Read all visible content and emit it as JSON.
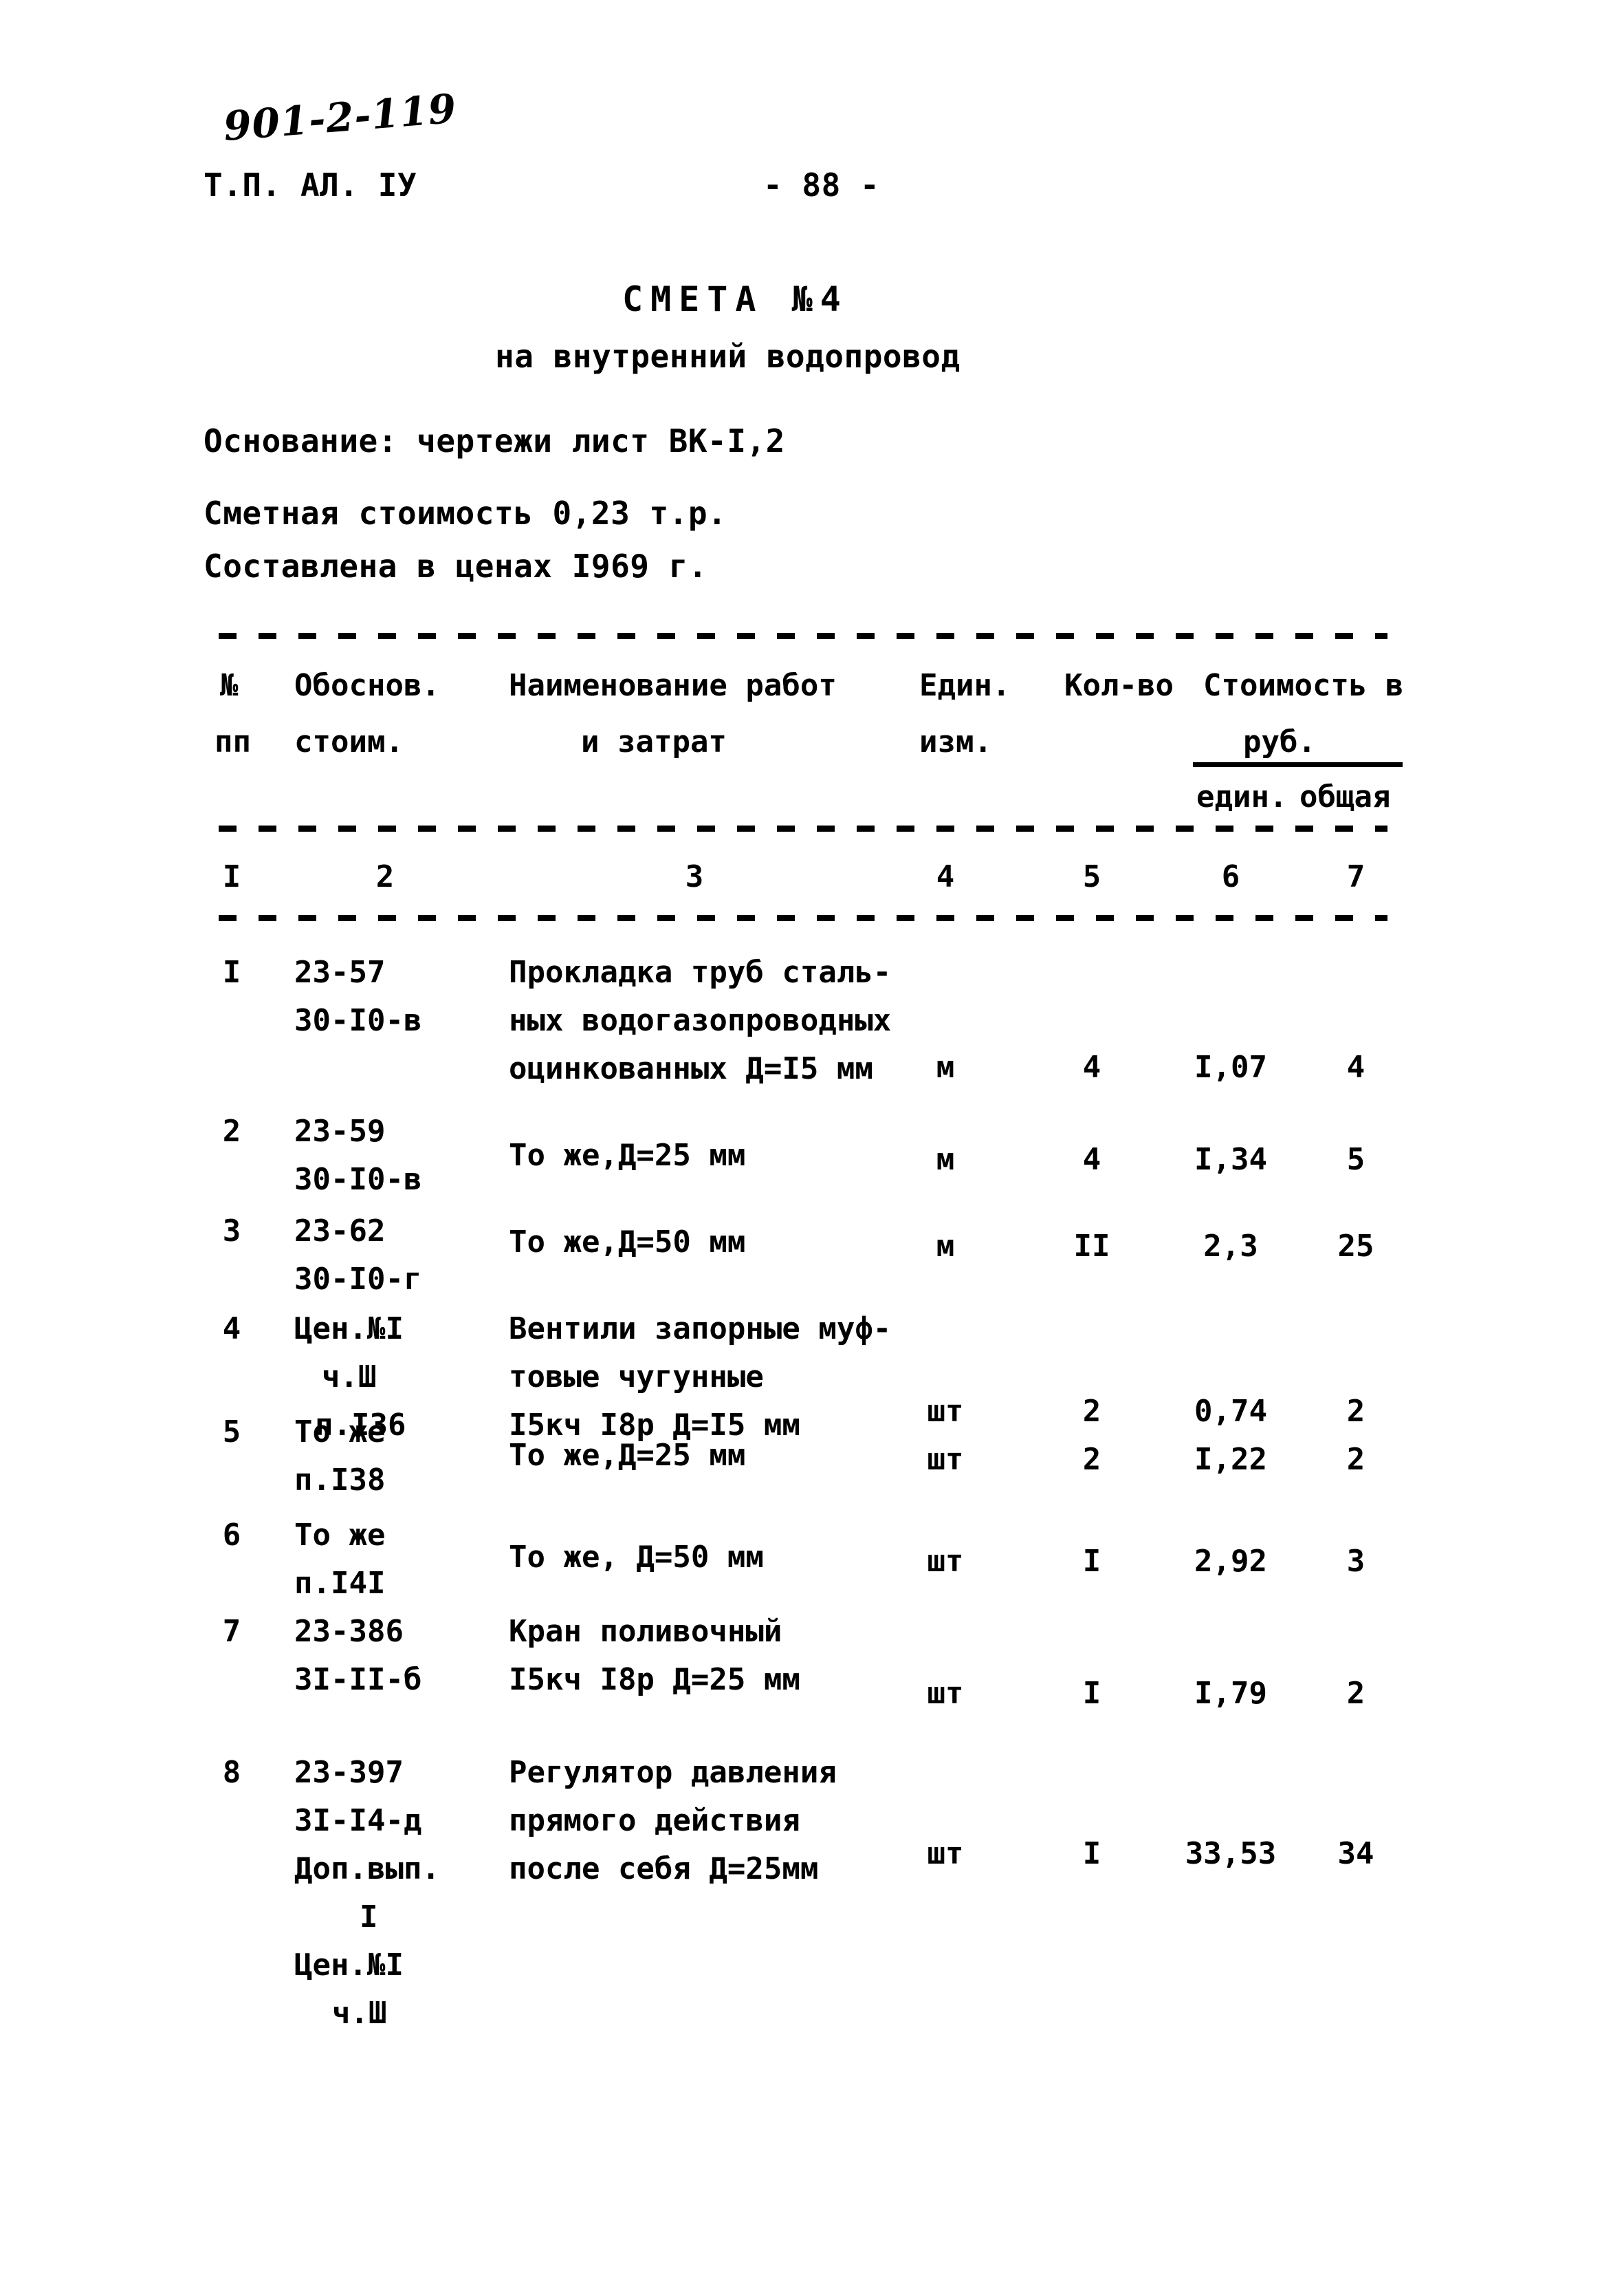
{
  "page": {
    "handwritten_code": "901-2-119",
    "doc_ref": "Т.П. АЛ. IУ",
    "page_number": "- 88 -"
  },
  "title": {
    "main": "СМЕТА №4",
    "subtitle": "на внутренний водопровод"
  },
  "preamble": {
    "basis": "Основание: чертежи лист ВК-I,2",
    "estimate_cost": "Сметная стоимость 0,23 т.р.",
    "prices_year": "Составлена в ценах I969 г."
  },
  "table": {
    "headers": {
      "num_line1": "№",
      "num_line2": "пп",
      "basis_line1": "Обоснов.",
      "basis_line2": "стоим.",
      "name_line1": "Наименование работ",
      "name_line2": "и затрат",
      "unit_line1": "Един.",
      "unit_line2": "изм.",
      "qty": "Кол-во",
      "cost_line1": "Стоимость в",
      "cost_line2": "руб.",
      "cost_sub_unit": "един.",
      "cost_sub_total": "общая"
    },
    "column_numbers": [
      "I",
      "2",
      "3",
      "4",
      "5",
      "6",
      "7"
    ],
    "rows": [
      {
        "no": "I",
        "basis": [
          "23-57",
          "30-I0-в"
        ],
        "name": [
          "Прокладка труб сталь-",
          "ных водогазопроводных",
          "оцинкованных Д=I5 мм"
        ],
        "unit": "м",
        "qty": "4",
        "unit_cost": "I,07",
        "total_cost": "4"
      },
      {
        "no": "2",
        "basis": [
          "23-59",
          "30-I0-в"
        ],
        "name": [
          "То же,Д=25 мм"
        ],
        "unit": "м",
        "qty": "4",
        "unit_cost": "I,34",
        "total_cost": "5"
      },
      {
        "no": "3",
        "basis": [
          "23-62",
          "30-I0-г"
        ],
        "name": [
          "То же,Д=50 мм"
        ],
        "unit": "м",
        "qty": "II",
        "unit_cost": "2,3",
        "total_cost": "25"
      },
      {
        "no": "4",
        "basis": [
          "Цен.№I",
          "ч.Ш",
          "п.I36"
        ],
        "name": [
          "Вентили запорные муф-",
          "товые чугунные",
          "I5кч I8р Д=I5 мм"
        ],
        "unit": "шт",
        "qty": "2",
        "unit_cost": "0,74",
        "total_cost": "2"
      },
      {
        "no": "5",
        "basis": [
          "То же",
          "п.I38"
        ],
        "name": [
          "То же,Д=25 мм"
        ],
        "unit": "шт",
        "qty": "2",
        "unit_cost": "I,22",
        "total_cost": "2"
      },
      {
        "no": "6",
        "basis": [
          "То же",
          "п.I4I"
        ],
        "name": [
          "То же, Д=50 мм"
        ],
        "unit": "шт",
        "qty": "I",
        "unit_cost": "2,92",
        "total_cost": "3"
      },
      {
        "no": "7",
        "basis": [
          "23-386",
          "3I-II-б"
        ],
        "name": [
          "Кран поливочный",
          "I5кч I8р Д=25 мм"
        ],
        "unit": "шт",
        "qty": "I",
        "unit_cost": "I,79",
        "total_cost": "2"
      },
      {
        "no": "8",
        "basis": [
          "23-397",
          "3I-I4-д",
          "Доп.вып.",
          "I",
          "Цен.№I",
          "ч.Ш"
        ],
        "name": [
          "Регулятор давления",
          "прямого действия",
          "после себя Д=25мм"
        ],
        "unit": "шт",
        "qty": "I",
        "unit_cost": "33,53",
        "total_cost": "34"
      }
    ]
  }
}
